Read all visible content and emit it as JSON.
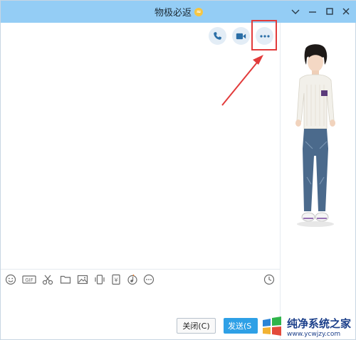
{
  "window": {
    "title": "物极必返",
    "vip_badge": "≈"
  },
  "chat": {
    "header_actions": [
      {
        "name": "voice-call",
        "icon": "phone-icon"
      },
      {
        "name": "video-call",
        "icon": "video-camera-icon"
      },
      {
        "name": "more",
        "icon": "more-dots-icon"
      }
    ]
  },
  "toolbar": {
    "icons": [
      "emoji-icon",
      "gif-icon",
      "screenshot-scissors-icon",
      "folder-icon",
      "image-icon",
      "shake-window-icon",
      "red-packet-icon",
      "music-icon",
      "more-icon",
      "history-clock-icon"
    ],
    "gif_label": "GIF",
    "red_packet_label": "¥"
  },
  "footer": {
    "close_label": "关闭(C)",
    "send_label": "发送(S"
  },
  "watermark": {
    "main": "纯净系统之家",
    "url": "www.ycwjzy.com"
  },
  "colors": {
    "titlebar": "#94cdf5",
    "send_button": "#2ea0e6",
    "highlight": "#e23b3b"
  }
}
